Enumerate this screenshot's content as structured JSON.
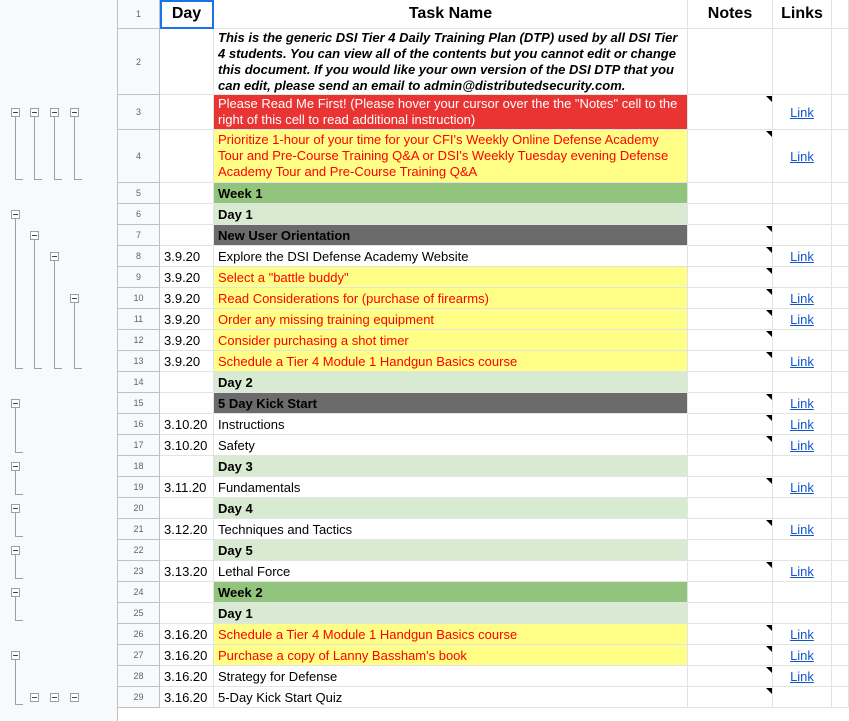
{
  "sheet": {
    "columns": [
      {
        "key": "day",
        "label": "Day"
      },
      {
        "key": "task",
        "label": "Task Name"
      },
      {
        "key": "notes",
        "label": "Notes"
      },
      {
        "key": "links",
        "label": "Links"
      }
    ],
    "rows": [
      {
        "n": "1",
        "type": "header"
      },
      {
        "n": "2",
        "type": "intro",
        "day": "",
        "task": "This is the generic DSI Tier 4 Daily Training Plan (DTP) used by all DSI Tier 4 students. You can view all of the contents but you cannot edit or change this document. If you would like your own version of the DSI DTP that you can edit, please send an email to admin@distributedsecurity.com.",
        "link": ""
      },
      {
        "n": "3",
        "type": "readme",
        "day": "",
        "task": "Please Read Me First! (Please hover your cursor over the the \"Notes\" cell to the right of this cell to read additional instruction)",
        "link": "Link",
        "note": true
      },
      {
        "n": "4",
        "type": "yellow",
        "day": "",
        "task": "Prioritize 1-hour of your time for your CFI's Weekly Online Defense Academy Tour and Pre-Course Training Q&A or DSI's Weekly Tuesday evening Defense Academy Tour and Pre-Course Training Q&A",
        "link": "Link",
        "note": true
      },
      {
        "n": "5",
        "type": "week",
        "day": "",
        "task": "Week 1",
        "link": ""
      },
      {
        "n": "6",
        "type": "dayrow",
        "day": "",
        "task": "Day 1",
        "link": ""
      },
      {
        "n": "7",
        "type": "section",
        "day": "",
        "task": "New User Orientation",
        "link": "",
        "note": true
      },
      {
        "n": "8",
        "type": "white",
        "day": "3.9.20",
        "task": "Explore the DSI Defense Academy Website",
        "link": "Link",
        "note": true
      },
      {
        "n": "9",
        "type": "yellow1",
        "day": "3.9.20",
        "task": "Select a \"battle buddy\"",
        "link": "",
        "note": true
      },
      {
        "n": "10",
        "type": "yellow1",
        "day": "3.9.20",
        "task": "Read Considerations for (purchase of firearms)",
        "link": "Link",
        "note": true
      },
      {
        "n": "11",
        "type": "yellow1",
        "day": "3.9.20",
        "task": "Order any missing training equipment",
        "link": "Link",
        "note": true
      },
      {
        "n": "12",
        "type": "yellow1",
        "day": "3.9.20",
        "task": "Consider purchasing a shot timer",
        "link": "",
        "note": true
      },
      {
        "n": "13",
        "type": "yellow1",
        "day": "3.9.20",
        "task": "Schedule a Tier 4 Module 1 Handgun Basics course",
        "link": "Link",
        "note": true
      },
      {
        "n": "14",
        "type": "dayrow",
        "day": "",
        "task": "Day 2",
        "link": ""
      },
      {
        "n": "15",
        "type": "section",
        "day": "",
        "task": "5 Day Kick Start",
        "link": "Link",
        "note": true
      },
      {
        "n": "16",
        "type": "white",
        "day": "3.10.20",
        "task": "Instructions",
        "link": "Link",
        "note": true
      },
      {
        "n": "17",
        "type": "white",
        "day": "3.10.20",
        "task": "Safety",
        "link": "Link",
        "note": true
      },
      {
        "n": "18",
        "type": "dayrow",
        "day": "",
        "task": "Day 3",
        "link": ""
      },
      {
        "n": "19",
        "type": "white",
        "day": "3.11.20",
        "task": "Fundamentals",
        "link": "Link",
        "note": true
      },
      {
        "n": "20",
        "type": "dayrow",
        "day": "",
        "task": "Day 4",
        "link": ""
      },
      {
        "n": "21",
        "type": "white",
        "day": "3.12.20",
        "task": "Techniques and Tactics",
        "link": "Link",
        "note": true
      },
      {
        "n": "22",
        "type": "dayrow",
        "day": "",
        "task": "Day 5",
        "link": ""
      },
      {
        "n": "23",
        "type": "white",
        "day": "3.13.20",
        "task": "Lethal Force",
        "link": "Link",
        "note": true
      },
      {
        "n": "24",
        "type": "week",
        "day": "",
        "task": "Week 2",
        "link": ""
      },
      {
        "n": "25",
        "type": "dayrow",
        "day": "",
        "task": "Day 1",
        "link": ""
      },
      {
        "n": "26",
        "type": "yellow1",
        "day": "3.16.20",
        "task": "Schedule a Tier 4 Module 1 Handgun Basics course",
        "link": "Link",
        "note": true
      },
      {
        "n": "27",
        "type": "yellow1",
        "day": "3.16.20",
        "task": "Purchase a copy of Lanny Bassham's book",
        "link": "Link",
        "note": true
      },
      {
        "n": "28",
        "type": "white",
        "day": "3.16.20",
        "task": "Strategy for Defense",
        "link": "Link",
        "note": true
      },
      {
        "n": "29",
        "type": "white",
        "day": "3.16.20",
        "task": "5-Day Kick Start Quiz",
        "link": "",
        "note": true
      }
    ]
  },
  "colors": {
    "readme_bg": "#ea3433",
    "yellow_bg": "#ffff88",
    "week_bg": "#93c47d",
    "day_bg": "#d9ead3",
    "section_bg": "#6b6b6b",
    "link": "#1155cc"
  }
}
